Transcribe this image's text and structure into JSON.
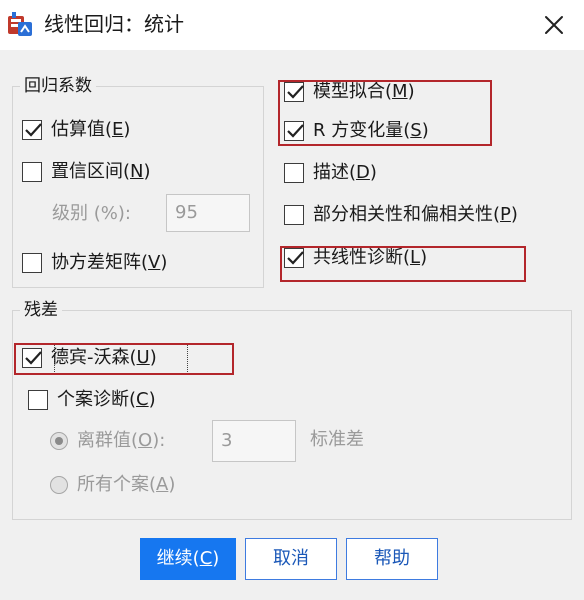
{
  "window": {
    "title": "线性回归：统计",
    "close_icon": "close-icon",
    "app_icon": "spss-app-icon"
  },
  "regression_coefficients": {
    "title": "回归系数",
    "estimates": {
      "label": "估算值(",
      "key": "E",
      "suffix": ")",
      "checked": true
    },
    "confidence_intervals": {
      "label": "置信区间(",
      "key": "N",
      "suffix": ")",
      "checked": false
    },
    "level": {
      "label": "级别 (%):",
      "value": "95"
    },
    "covariance_matrix": {
      "label": "协方差矩阵(",
      "key": "V",
      "suffix": ")",
      "checked": false
    }
  },
  "model_options": {
    "model_fit": {
      "label": "模型拟合(",
      "key": "M",
      "suffix": ")",
      "checked": true
    },
    "r_squared_change": {
      "label": "R 方变化量(",
      "key": "S",
      "suffix": ")",
      "checked": true
    },
    "descriptives": {
      "label": "描述(",
      "key": "D",
      "suffix": ")",
      "checked": false
    },
    "part_partial": {
      "label": "部分相关性和偏相关性(",
      "key": "P",
      "suffix": ")",
      "checked": false
    },
    "collinearity": {
      "label": "共线性诊断(",
      "key": "L",
      "suffix": ")",
      "checked": true
    }
  },
  "residuals": {
    "title": "残差",
    "durbin_watson": {
      "label": "德宾-沃森(",
      "key": "U",
      "suffix": ")",
      "checked": true
    },
    "casewise": {
      "label": "个案诊断(",
      "key": "C",
      "suffix": ")",
      "checked": false
    },
    "outliers": {
      "label": "离群值(",
      "key": "O",
      "suffix": "):",
      "selected": true,
      "value": "3",
      "unit": "标准差"
    },
    "all_cases": {
      "label": "所有个案(",
      "key": "A",
      "suffix": ")",
      "selected": false
    }
  },
  "buttons": {
    "continue": {
      "label": "继续(",
      "key": "C",
      "suffix": ")"
    },
    "cancel": "取消",
    "help": "帮助"
  },
  "colors": {
    "accent": "#1677f0",
    "highlight": "#b3262b",
    "background": "#f0f0f0"
  }
}
